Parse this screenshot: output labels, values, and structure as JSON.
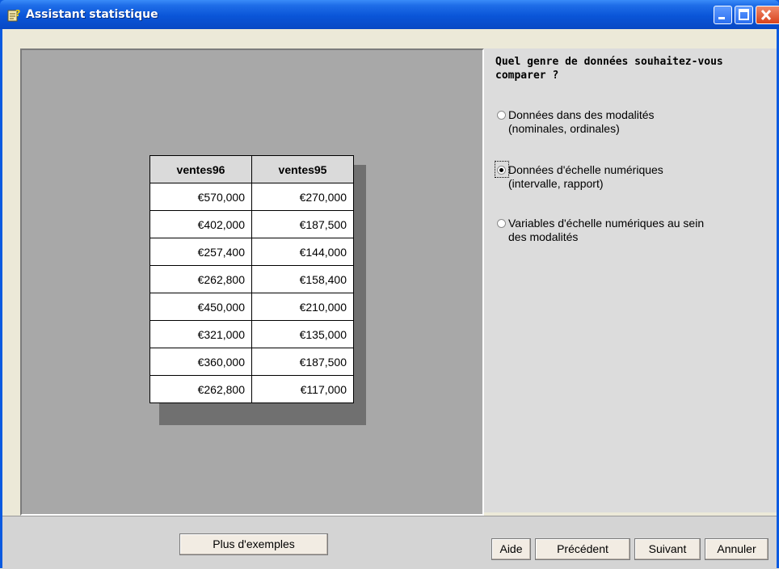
{
  "window": {
    "title": "Assistant statistique"
  },
  "table": {
    "headers": [
      "ventes96",
      "ventes95"
    ],
    "rows": [
      [
        "€570,000",
        "€270,000"
      ],
      [
        "€402,000",
        "€187,500"
      ],
      [
        "€257,400",
        "€144,000"
      ],
      [
        "€262,800",
        "€158,400"
      ],
      [
        "€450,000",
        "€210,000"
      ],
      [
        "€321,000",
        "€135,000"
      ],
      [
        "€360,000",
        "€187,500"
      ],
      [
        "€262,800",
        "€117,000"
      ]
    ]
  },
  "question": "Quel genre de données souhaitez-vous comparer ?",
  "options": [
    {
      "line1": "Données dans des modalités",
      "line2": "(nominales, ordinales)",
      "selected": false
    },
    {
      "line1": "Données d'échelle numériques",
      "line2": "(intervalle, rapport)",
      "selected": true
    },
    {
      "line1": "Variables d'échelle numériques au sein",
      "line2": "des modalités",
      "selected": false
    }
  ],
  "buttons": {
    "more_examples": "Plus d'exemples",
    "help": "Aide",
    "previous": "Précédent",
    "next": "Suivant",
    "cancel": "Annuler"
  },
  "colors": {
    "titlebar": "#0a55d8",
    "panel": "#a8a8a8",
    "close": "#d8431c"
  },
  "icons": {
    "app": "wizard-icon",
    "minimize": "minimize-icon",
    "maximize": "maximize-icon",
    "close": "close-icon"
  }
}
